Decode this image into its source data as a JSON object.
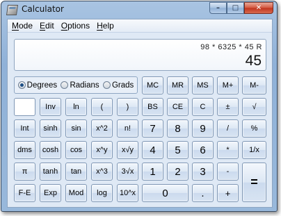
{
  "window": {
    "title": "Calculator",
    "buttons": {
      "minimize": "–",
      "maximize": "□",
      "close": "✕"
    }
  },
  "menu": [
    {
      "first": "M",
      "rest": "ode"
    },
    {
      "first": "E",
      "rest": "dit"
    },
    {
      "first": "O",
      "rest": "ptions"
    },
    {
      "first": "H",
      "rest": "elp"
    }
  ],
  "display": {
    "expression": "98 * 6325 * 45 R",
    "result": "45"
  },
  "angle_units": {
    "degrees": "Degrees",
    "radians": "Radians",
    "grads": "Grads",
    "selected": "Degrees"
  },
  "memory": {
    "mc": "MC",
    "mr": "MR",
    "ms": "MS",
    "mplus": "M+",
    "mminus": "M-"
  },
  "rows": {
    "r1": {
      "blank": "",
      "inv": "Inv",
      "ln": "ln",
      "lparen": "(",
      "rparen": ")",
      "bs": "BS",
      "ce": "CE",
      "c": "C",
      "plusminus": "±",
      "sqrt": "√"
    },
    "r2": {
      "int": "Int",
      "sinh": "sinh",
      "sin": "sin",
      "x2": "x^2",
      "fact": "n!",
      "n7": "7",
      "n8": "8",
      "n9": "9",
      "div": "/",
      "pct": "%"
    },
    "r3": {
      "dms": "dms",
      "cosh": "cosh",
      "cos": "cos",
      "xy": "x^y",
      "yroot": "x√y",
      "n4": "4",
      "n5": "5",
      "n6": "6",
      "mul": "*",
      "recip": "1/x"
    },
    "r4": {
      "pi": "π",
      "tanh": "tanh",
      "tan": "tan",
      "x3": "x^3",
      "cbrt": "3√x",
      "n1": "1",
      "n2": "2",
      "n3": "3",
      "sub": "-",
      "eq": "="
    },
    "r5": {
      "fe": "F-E",
      "exp": "Exp",
      "mod": "Mod",
      "log": "log",
      "tenx": "10^x",
      "n0": "0",
      "dot": ".",
      "add": "+"
    }
  }
}
